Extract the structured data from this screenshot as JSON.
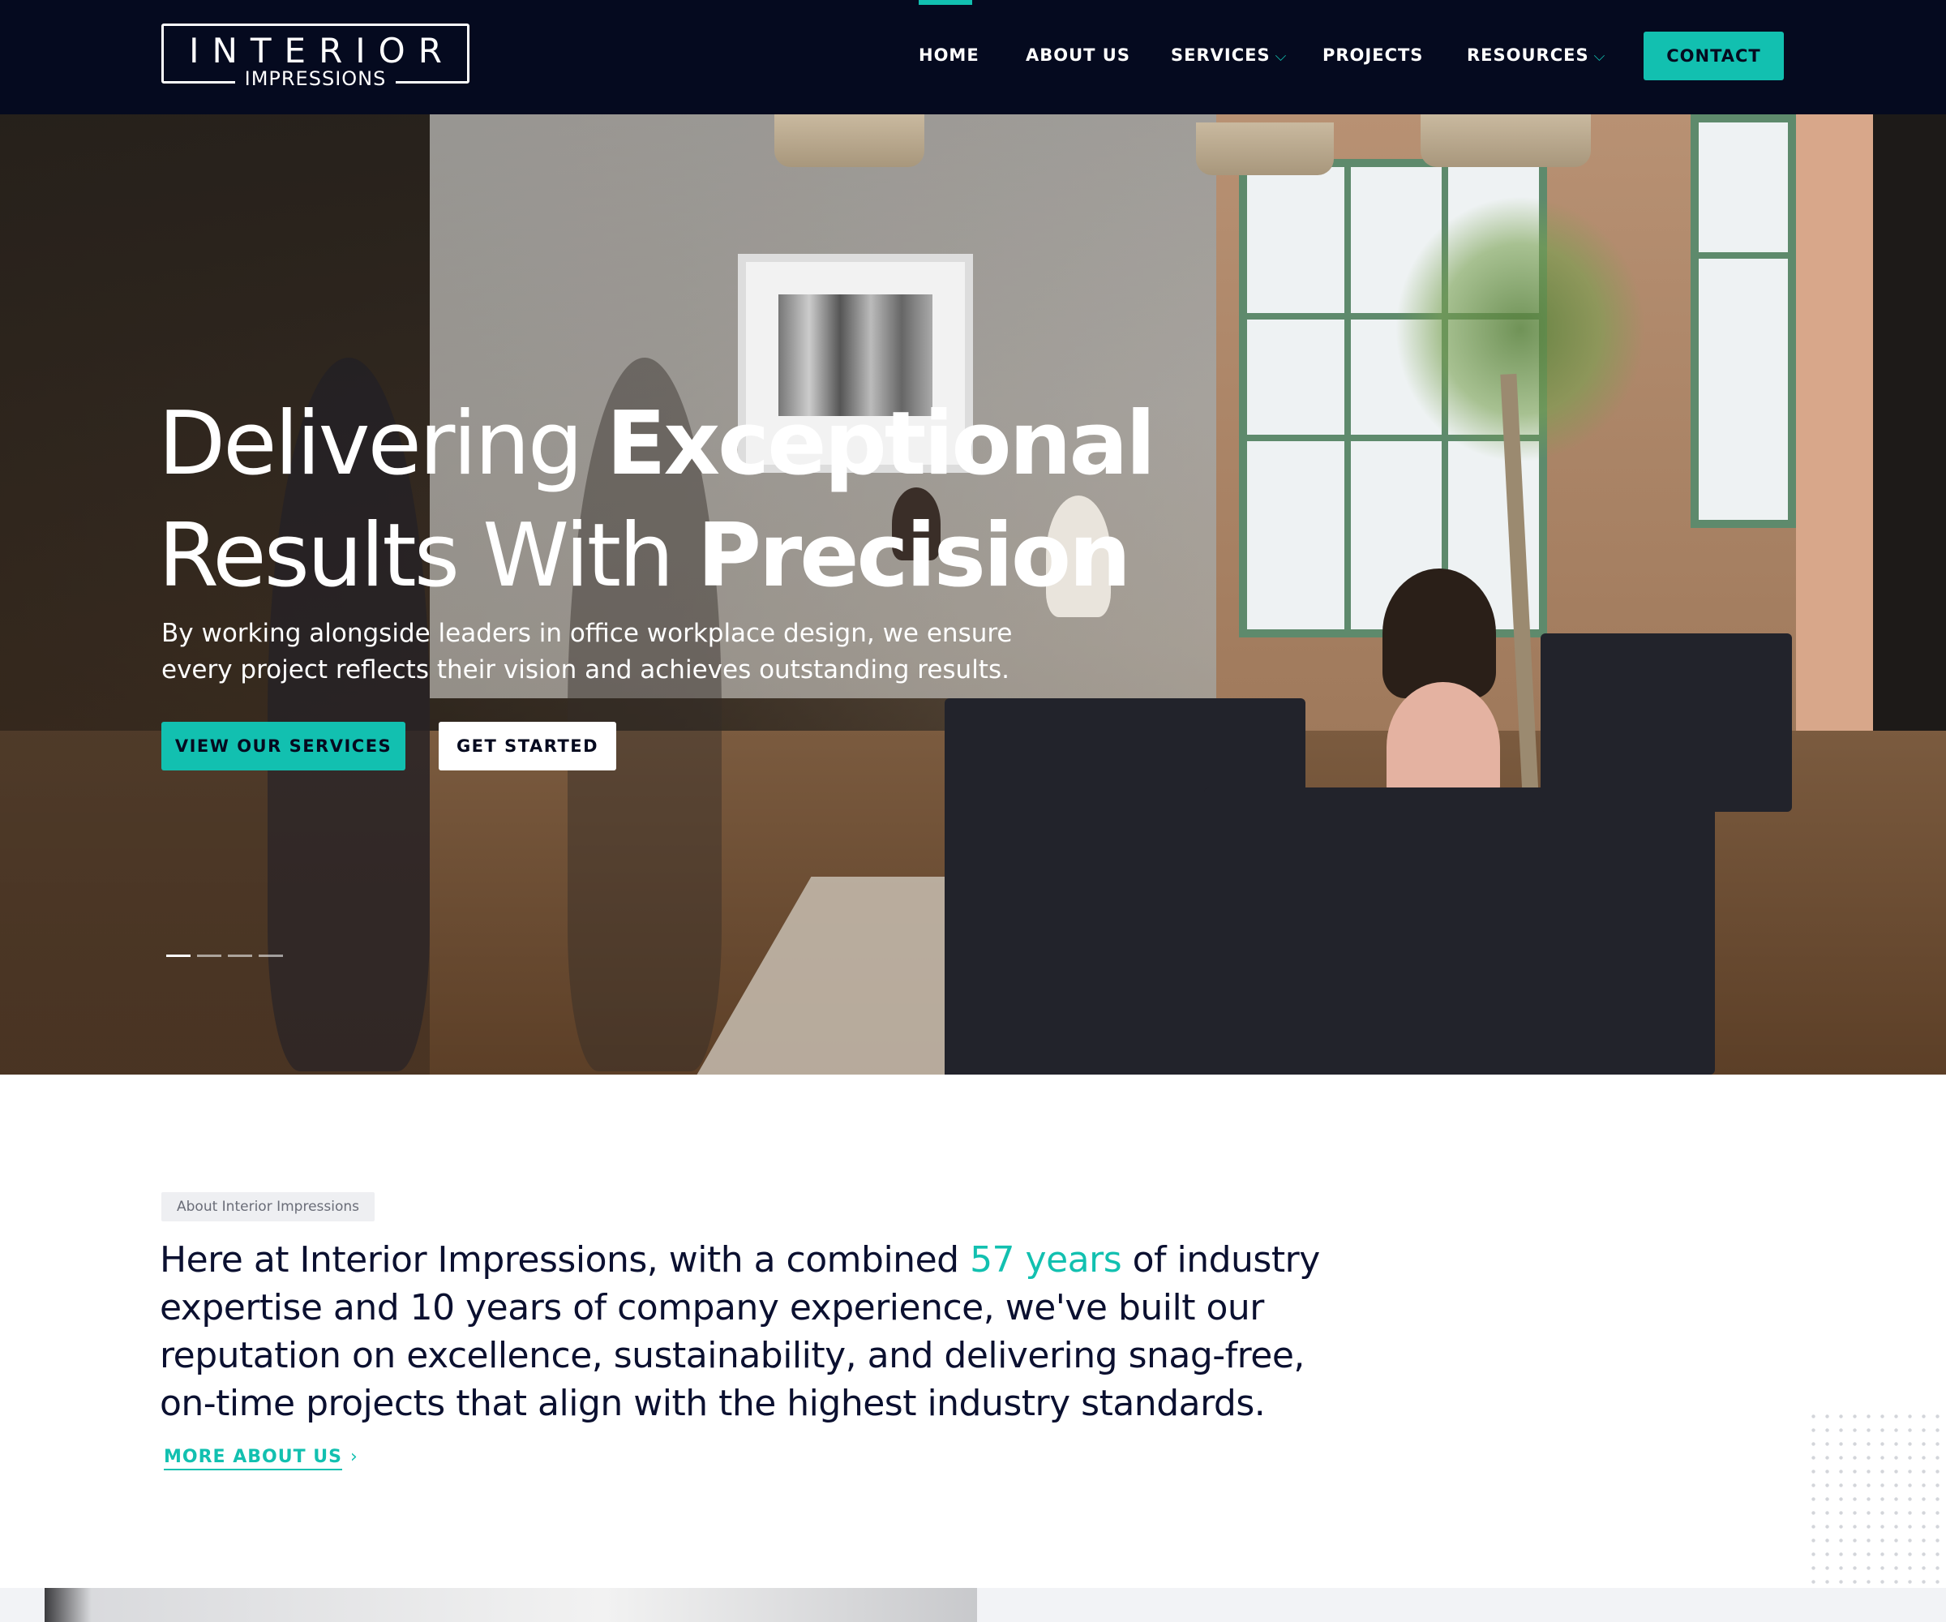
{
  "header": {
    "logo": {
      "top": "INTERIOR",
      "bottom": "IMPRESSIONS"
    },
    "nav": [
      {
        "label": "HOME",
        "active": true
      },
      {
        "label": "ABOUT US"
      },
      {
        "label": "SERVICES",
        "dropdown": true
      },
      {
        "label": "PROJECTS"
      },
      {
        "label": "RESOURCES",
        "dropdown": true
      }
    ],
    "contact_label": "CONTACT",
    "dropdown_glyph": "⌵"
  },
  "hero": {
    "title_line1_regular": "Delivering ",
    "title_line1_bold": "Exceptional",
    "title_line2_regular": "Results With ",
    "title_line2_bold": "Precision",
    "subtitle_line1": "By working alongside leaders in office workplace design, we ensure",
    "subtitle_line2": "every project reflects their vision and achieves outstanding results.",
    "primary_button": "VIEW OUR SERVICES",
    "secondary_button": "GET STARTED",
    "slider": {
      "total": 4,
      "active": 1
    }
  },
  "about": {
    "tag": "About Interior Impressions",
    "text_before": "Here at Interior Impressions, with a combined ",
    "text_accent": "57 years",
    "text_after": " of industry expertise and 10 years of company experience, we've built our reputation on excellence, sustainability, and delivering snag-free, on-time projects that align with the highest industry standards.",
    "link_label": "MORE ABOUT US",
    "link_arrow": "›"
  },
  "colors": {
    "header_bg": "#050a1f",
    "accent": "#12c0b0",
    "text_dark": "#0b1030"
  },
  "icons": [
    "chevron-down-icon",
    "chevron-right-icon"
  ]
}
